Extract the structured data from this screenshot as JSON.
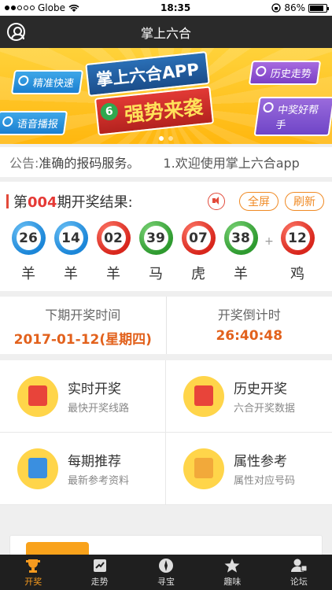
{
  "status": {
    "carrier": "Globe",
    "time": "18:35",
    "battery": "86%",
    "battery_level": 0.86
  },
  "nav": {
    "title": "掌上六合"
  },
  "banner": {
    "chips": {
      "fast": "精准快速",
      "voice": "语音播报",
      "trend": "历史走势",
      "helper": "中奖好帮手"
    },
    "headline1": "掌上六合APP",
    "headline2": "强势来袭",
    "badge_num": "6"
  },
  "notice": {
    "prefix": "公告:",
    "text1": "准确的报码服务。",
    "text2": "1.欢迎使用掌上六合app"
  },
  "result": {
    "title_pre": "第",
    "issue": "004",
    "title_post": "期开奖结果:",
    "fullscreen": "全屏",
    "refresh": "刷新",
    "balls": [
      {
        "num": "26",
        "zodiac": "羊",
        "color": "blue"
      },
      {
        "num": "14",
        "zodiac": "羊",
        "color": "blue"
      },
      {
        "num": "02",
        "zodiac": "羊",
        "color": "red"
      },
      {
        "num": "39",
        "zodiac": "马",
        "color": "green"
      },
      {
        "num": "07",
        "zodiac": "虎",
        "color": "red"
      },
      {
        "num": "38",
        "zodiac": "羊",
        "color": "green"
      }
    ],
    "plus": "+",
    "special": {
      "num": "12",
      "zodiac": "鸡",
      "color": "red"
    }
  },
  "next_draw": {
    "time_label": "下期开奖时间",
    "time_value": "2017-01-12(星期四)",
    "countdown_label": "开奖倒计时",
    "countdown_value": "26:40:48"
  },
  "features": [
    {
      "title": "实时开奖",
      "sub": "最快开奖线路"
    },
    {
      "title": "历史开奖",
      "sub": "六合开奖数据"
    },
    {
      "title": "每期推荐",
      "sub": "最新参考资料"
    },
    {
      "title": "属性参考",
      "sub": "属性对应号码"
    }
  ],
  "tabs": [
    {
      "label": "开奖"
    },
    {
      "label": "走势"
    },
    {
      "label": "寻宝"
    },
    {
      "label": "趣味"
    },
    {
      "label": "论坛"
    }
  ],
  "colors": {
    "accent": "#f59a1f",
    "issue": "#e53935",
    "value": "#e2611c"
  }
}
